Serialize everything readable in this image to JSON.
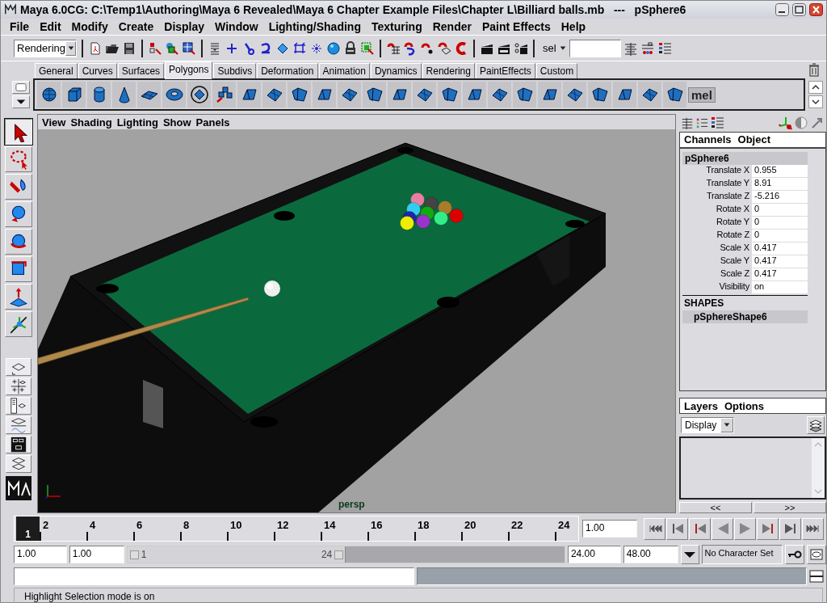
{
  "window": {
    "title": "Maya 6.0CG: C:\\Temp1\\Authoring\\Maya 6 Revealed\\Maya 6 Chapter Example Files\\Chapter L\\Billiard balls.mb   ---   pSphere6"
  },
  "menu": [
    "File",
    "Edit",
    "Modify",
    "Create",
    "Display",
    "Window",
    "Lighting/Shading",
    "Texturing",
    "Render",
    "Paint Effects",
    "Help"
  ],
  "status_line": {
    "menu_set": "Rendering",
    "selection_label": "sel"
  },
  "shelf_tabs": [
    {
      "label": "General",
      "selected": false
    },
    {
      "label": "Curves",
      "selected": false
    },
    {
      "label": "Surfaces",
      "selected": false
    },
    {
      "label": "Polygons",
      "selected": true
    },
    {
      "label": "Subdivs",
      "selected": false
    },
    {
      "label": "Deformation",
      "selected": false
    },
    {
      "label": "Animation",
      "selected": false
    },
    {
      "label": "Dynamics",
      "selected": false
    },
    {
      "label": "Rendering",
      "selected": false
    },
    {
      "label": "PaintEffects",
      "selected": false
    },
    {
      "label": "Custom",
      "selected": false
    }
  ],
  "shelf": {
    "script_button": "mel"
  },
  "tools": [
    {
      "kind": "select",
      "selected": true
    },
    {
      "kind": "lasso",
      "selected": false
    },
    {
      "kind": "paint",
      "selected": false
    },
    {
      "kind": "move",
      "selected": false
    },
    {
      "kind": "rotate",
      "selected": false
    },
    {
      "kind": "scale",
      "selected": false
    },
    {
      "kind": "manipulator",
      "selected": false
    },
    {
      "kind": "last",
      "selected": false
    }
  ],
  "viewport": {
    "menu": [
      "View",
      "Shading",
      "Lighting",
      "Show",
      "Panels"
    ],
    "camera": "persp"
  },
  "channel_box": {
    "menu": [
      "Channels",
      "Object"
    ],
    "node": "pSphere6",
    "channels": [
      {
        "name": "Translate X",
        "value": "0.955"
      },
      {
        "name": "Translate Y",
        "value": "8.91"
      },
      {
        "name": "Translate Z",
        "value": "-5.216"
      },
      {
        "name": "Rotate X",
        "value": "0"
      },
      {
        "name": "Rotate Y",
        "value": "0"
      },
      {
        "name": "Rotate Z",
        "value": "0"
      },
      {
        "name": "Scale X",
        "value": "0.417"
      },
      {
        "name": "Scale Y",
        "value": "0.417"
      },
      {
        "name": "Scale Z",
        "value": "0.417"
      },
      {
        "name": "Visibility",
        "value": "on"
      }
    ],
    "shapes_header": "SHAPES",
    "shape": "pSphereShape6"
  },
  "layers": {
    "menu": [
      "Layers",
      "Options"
    ],
    "mode": "Display"
  },
  "pager": [
    "<<",
    ">>"
  ],
  "time_slider": {
    "current_frame": "1",
    "level": 0,
    "ticks": [
      "2",
      "4",
      "6",
      "8",
      "10",
      "12",
      "14",
      "16",
      "18",
      "20",
      "22",
      "24"
    ],
    "current_time": "1.00"
  },
  "range": {
    "start": "1.00",
    "playback_start": "1.00",
    "slider_start": "1",
    "slider_end": "24",
    "level": 0.5,
    "playback_end": "24.00",
    "end": "48.00",
    "character_set": "No Character Set"
  },
  "help_line": "Highlight Selection mode is on"
}
